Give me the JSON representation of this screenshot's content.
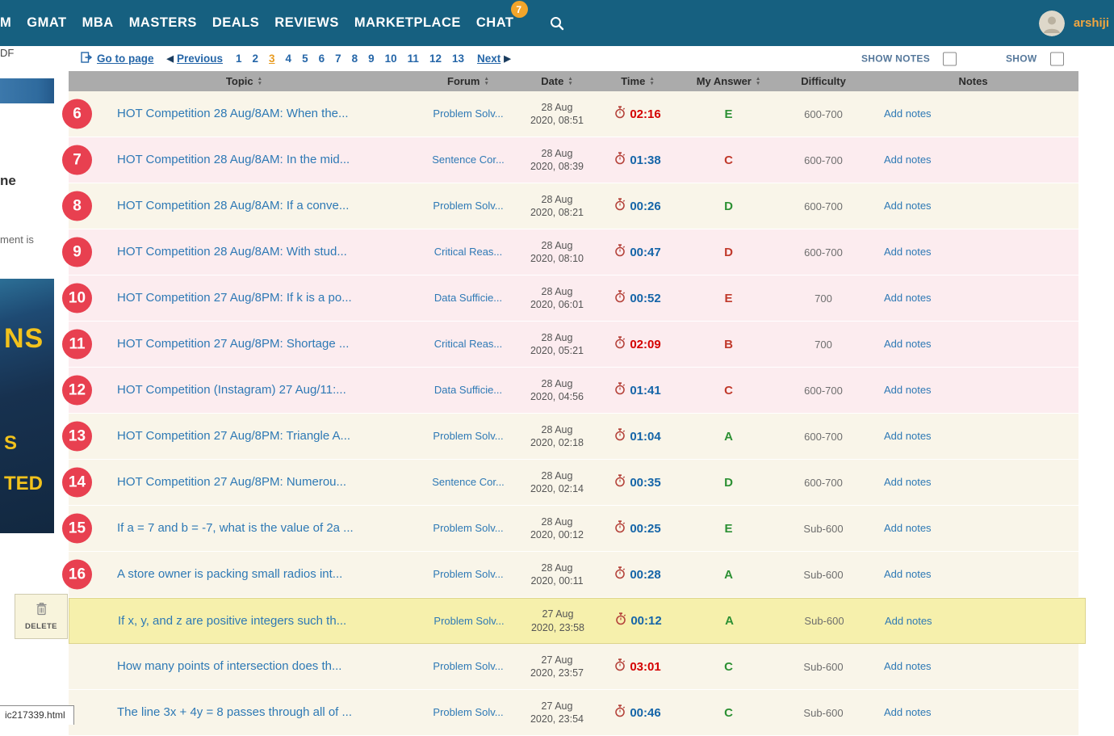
{
  "nav": {
    "items": [
      "M",
      "GMAT",
      "MBA",
      "MASTERS",
      "DEALS",
      "REVIEWS",
      "MARKETPLACE",
      "CHAT"
    ],
    "chat_badge": "7",
    "username": "arshiji"
  },
  "pagination": {
    "go_to_page_label": "Go to page",
    "previous_label": "Previous",
    "next_label": "Next",
    "pages": [
      "1",
      "2",
      "3",
      "4",
      "5",
      "6",
      "7",
      "8",
      "9",
      "10",
      "11",
      "12",
      "13"
    ],
    "current_page": "3"
  },
  "toggles": {
    "show_notes_label": "SHOW NOTES",
    "show_label": "SHOW"
  },
  "table": {
    "headers": {
      "topic": "Topic",
      "forum": "Forum",
      "date": "Date",
      "time": "Time",
      "answer": "My Answer",
      "difficulty": "Difficulty",
      "notes": "Notes"
    },
    "rows": [
      {
        "badge": "6",
        "topic": "HOT Competition 28 Aug/8AM: When the...",
        "forum": "Problem Solv...",
        "date_line1": "28 Aug",
        "date_line2": "2020, 08:51",
        "time": "02:16",
        "time_over": true,
        "answer": "E",
        "answer_correct": true,
        "difficulty": "600-700",
        "notes": "Add notes",
        "state": "ok"
      },
      {
        "badge": "7",
        "topic": "HOT Competition 28 Aug/8AM: In the mid...",
        "forum": "Sentence Cor...",
        "date_line1": "28 Aug",
        "date_line2": "2020, 08:39",
        "time": "01:38",
        "time_over": false,
        "answer": "C",
        "answer_correct": false,
        "difficulty": "600-700",
        "notes": "Add notes",
        "state": "wrong"
      },
      {
        "badge": "8",
        "topic": "HOT Competition 28 Aug/8AM: If a conve...",
        "forum": "Problem Solv...",
        "date_line1": "28 Aug",
        "date_line2": "2020, 08:21",
        "time": "00:26",
        "time_over": false,
        "answer": "D",
        "answer_correct": true,
        "difficulty": "600-700",
        "notes": "Add notes",
        "state": "ok"
      },
      {
        "badge": "9",
        "topic": "HOT Competition 28 Aug/8AM: With stud...",
        "forum": "Critical Reas...",
        "date_line1": "28 Aug",
        "date_line2": "2020, 08:10",
        "time": "00:47",
        "time_over": false,
        "answer": "D",
        "answer_correct": false,
        "difficulty": "600-700",
        "notes": "Add notes",
        "state": "wrong"
      },
      {
        "badge": "10",
        "topic": "HOT Competition 27 Aug/8PM: If k is a po...",
        "forum": "Data Sufficie...",
        "date_line1": "28 Aug",
        "date_line2": "2020, 06:01",
        "time": "00:52",
        "time_over": false,
        "answer": "E",
        "answer_correct": false,
        "difficulty": "700",
        "notes": "Add notes",
        "state": "wrong"
      },
      {
        "badge": "11",
        "topic": "HOT Competition 27 Aug/8PM: Shortage ...",
        "forum": "Critical Reas...",
        "date_line1": "28 Aug",
        "date_line2": "2020, 05:21",
        "time": "02:09",
        "time_over": true,
        "answer": "B",
        "answer_correct": false,
        "difficulty": "700",
        "notes": "Add notes",
        "state": "wrong"
      },
      {
        "badge": "12",
        "topic": "HOT Competition (Instagram) 27 Aug/11:...",
        "forum": "Data Sufficie...",
        "date_line1": "28 Aug",
        "date_line2": "2020, 04:56",
        "time": "01:41",
        "time_over": false,
        "answer": "C",
        "answer_correct": false,
        "difficulty": "600-700",
        "notes": "Add notes",
        "state": "wrong"
      },
      {
        "badge": "13",
        "topic": "HOT Competition 27 Aug/8PM: Triangle A...",
        "forum": "Problem Solv...",
        "date_line1": "28 Aug",
        "date_line2": "2020, 02:18",
        "time": "01:04",
        "time_over": false,
        "answer": "A",
        "answer_correct": true,
        "difficulty": "600-700",
        "notes": "Add notes",
        "state": "ok"
      },
      {
        "badge": "14",
        "topic": "HOT Competition 27 Aug/8PM: Numerou...",
        "forum": "Sentence Cor...",
        "date_line1": "28 Aug",
        "date_line2": "2020, 02:14",
        "time": "00:35",
        "time_over": false,
        "answer": "D",
        "answer_correct": true,
        "difficulty": "600-700",
        "notes": "Add notes",
        "state": "ok"
      },
      {
        "badge": "15",
        "topic": "If a = 7 and b = -7, what is the value of 2a ...",
        "forum": "Problem Solv...",
        "date_line1": "28 Aug",
        "date_line2": "2020, 00:12",
        "time": "00:25",
        "time_over": false,
        "answer": "E",
        "answer_correct": true,
        "difficulty": "Sub-600",
        "notes": "Add notes",
        "state": "ok"
      },
      {
        "badge": "16",
        "topic": "A store owner is packing small radios int...",
        "forum": "Problem Solv...",
        "date_line1": "28 Aug",
        "date_line2": "2020, 00:11",
        "time": "00:28",
        "time_over": false,
        "answer": "A",
        "answer_correct": true,
        "difficulty": "Sub-600",
        "notes": "Add notes",
        "state": "ok"
      },
      {
        "badge": null,
        "topic": "If x, y, and z are positive integers such th...",
        "forum": "Problem Solv...",
        "date_line1": "27 Aug",
        "date_line2": "2020, 23:58",
        "time": "00:12",
        "time_over": false,
        "answer": "A",
        "answer_correct": true,
        "difficulty": "Sub-600",
        "notes": "Add notes",
        "state": "highlight"
      },
      {
        "badge": null,
        "topic": "How many points of intersection does th...",
        "forum": "Problem Solv...",
        "date_line1": "27 Aug",
        "date_line2": "2020, 23:57",
        "time": "03:01",
        "time_over": true,
        "answer": "C",
        "answer_correct": true,
        "difficulty": "Sub-600",
        "notes": "Add notes",
        "state": "ok"
      },
      {
        "badge": null,
        "topic": "The line 3x + 4y = 8 passes through all of ...",
        "forum": "Problem Solv...",
        "date_line1": "27 Aug",
        "date_line2": "2020, 23:54",
        "time": "00:46",
        "time_over": false,
        "answer": "C",
        "answer_correct": true,
        "difficulty": "Sub-600",
        "notes": "Add notes",
        "state": "ok"
      }
    ]
  },
  "sidebar": {
    "fragment_top": "DF",
    "fragment_heading": "ne",
    "fragment_text": "ment is",
    "banner_lines": [
      "NS",
      "S",
      "TED"
    ],
    "delete_label": "DELETE"
  },
  "statusbar": {
    "text": "ic217339.html"
  },
  "colors": {
    "nav_bg": "#166080",
    "chat_badge": "#f2a52b",
    "username": "#f0a640",
    "link_blue": "#2e79b5",
    "current_page": "#e89b20",
    "badge_red": "#e84050",
    "row_correct_bg": "#f9f5e9",
    "row_wrong_bg": "#fcecef",
    "row_highlight_bg": "#f6f0ac",
    "header_gray": "#ababab",
    "time_normal": "#1565a8",
    "time_over": "#d40000",
    "answer_correct": "#2c9033",
    "answer_wrong": "#c0392b"
  }
}
